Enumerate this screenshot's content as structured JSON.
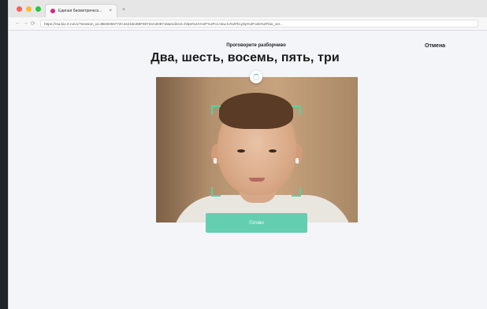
{
  "browser": {
    "tab_title": "Единая биометрическ...",
    "tab_close": "×",
    "new_tab": "+",
    "nav_back": "←",
    "nav_forward": "→",
    "nav_reload": "⟳",
    "url": "https://rsa.bio.rt.ru/v1/?session_id=8B39456772C3421B1B8F69734A2D8715&redirect=https%3A%2F%2Fcs.tinw.ru%2Fbi.php%2Fonb%2Fbio_ver...",
    "traffic_colors": [
      "#ff5f57",
      "#febc2e",
      "#28c840"
    ],
    "favicon_color": "#cc2b8a"
  },
  "page": {
    "instruction": "Проговорите разборчиво",
    "phrase": "Два, шесть, восемь, пять, три",
    "cancel_label": "Отмена",
    "ready_button_label": "Готово",
    "accent_color": "#63ceb0",
    "frame_color": "#59d0a5"
  }
}
